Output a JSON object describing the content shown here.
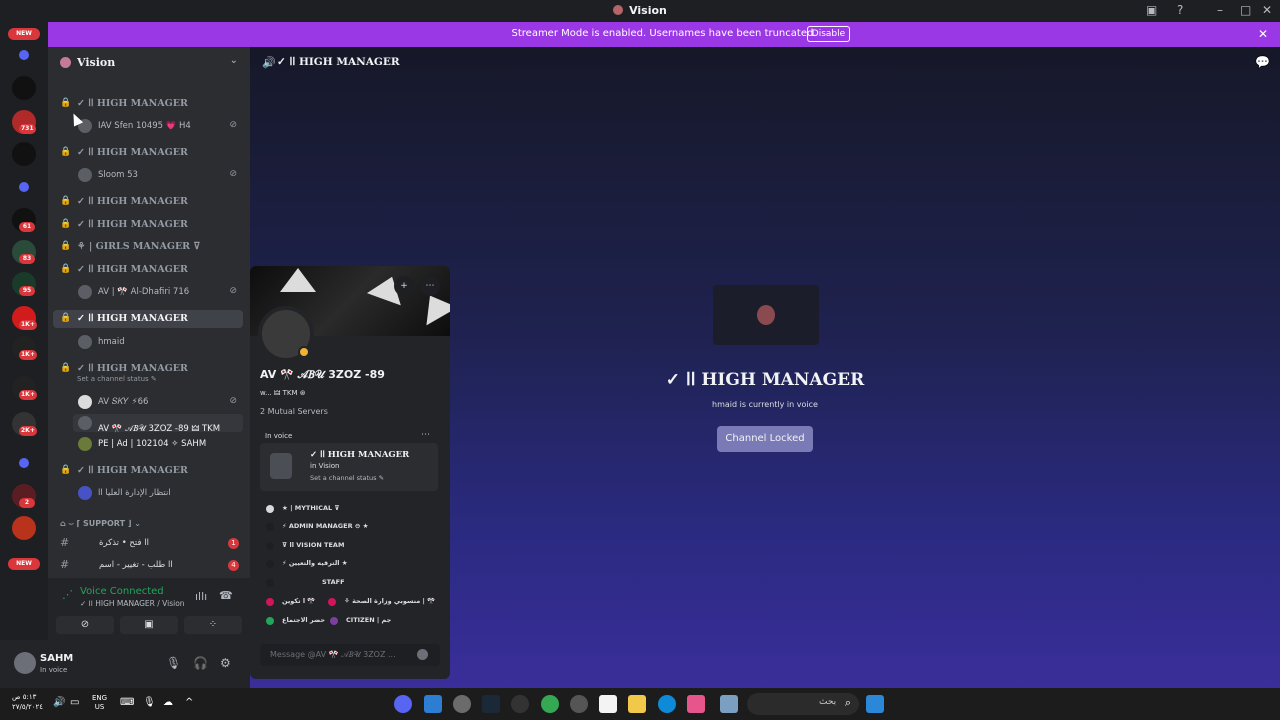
{
  "window": {
    "title": "Vision"
  },
  "banner": {
    "message": "Streamer Mode is enabled. Usernames have been truncated.",
    "disable_label": "Disable"
  },
  "guilds": {
    "new_top": "NEW",
    "badges": [
      "731",
      "61",
      "83",
      "95",
      "1K+",
      "1K+",
      "1K+",
      "2K+",
      "2"
    ],
    "new_bottom": "NEW"
  },
  "server": {
    "name": "Vision"
  },
  "channels": [
    {
      "label": "✓ اا HIGH MANAGER",
      "users": [
        {
          "name": "IAV Sfen 10495 💗 H4"
        }
      ]
    },
    {
      "label": "✓ اا HIGH MANAGER",
      "users": [
        {
          "name": "Sloom 53"
        }
      ]
    },
    {
      "label": "✓ اا HIGH MANAGER",
      "users": []
    },
    {
      "label": "✓ اا HIGH MANAGER",
      "users": []
    },
    {
      "label": "⚘ | GIRLS MANAGER ⊽",
      "users": []
    },
    {
      "label": "✓ اا HIGH MANAGER",
      "users": [
        {
          "name": "AV | 🎌 Al-Dhafiri 716"
        }
      ]
    },
    {
      "label": "✓ اا HIGH MANAGER",
      "users": [
        {
          "name": "hmaid"
        }
      ]
    },
    {
      "label": "✓ اا HIGH MANAGER",
      "status": "Set a channel status ✎",
      "users": [
        {
          "name": "AV 𝑆𝐾𝑌 ⚡66"
        },
        {
          "name": "AV 🎌 𝒜𝐵𝒰 3ZOZ -89 🜲 TKM"
        },
        {
          "name": "PE | Ad | 102104 ✧ SAHM"
        }
      ]
    },
    {
      "label": "✓ اا HIGH MANAGER",
      "users": [
        {
          "name": "انتظار الإدارة العليا اا"
        }
      ]
    }
  ],
  "category": {
    "label": "⌂ ⌣ ⌈ SUPPORT ⌋ ⌄"
  },
  "text_channels": [
    {
      "label": "اا فتح • تذكرة",
      "count": "1"
    },
    {
      "label": "اا طلب - تغيير - اسم",
      "count": "4"
    }
  ],
  "voice": {
    "status": "Voice Connected",
    "channel": "✓ اا HIGH MANAGER / Vision"
  },
  "user": {
    "name": "SAHM",
    "status": "In voice"
  },
  "main": {
    "header": "✓ اا HIGH MANAGER",
    "title": "✓ اا HIGH MANAGER",
    "subtitle": "hmaid is currently in voice",
    "locked_label": "Channel Locked"
  },
  "popout": {
    "name": "AV 🎌 𝒜𝐵𝒰 3ZOZ -89",
    "tag": "w... 🜲 TKM ⊛",
    "mutual": "2 Mutual Servers",
    "in_voice_label": "In voice",
    "voice_channel": "✓ اا HIGH MANAGER",
    "voice_in": "in Vision",
    "voice_status": "Set a channel status ✎",
    "roles": [
      {
        "label": "★ | MYTHICAL ⊽",
        "color": "#d9d9d9"
      },
      {
        "label": "⚡ ADMIN MANAGER ⊖ ★",
        "color": "#1e1f22"
      },
      {
        "label": "⊽ اا VISION TEAM",
        "color": "#1e1f22"
      },
      {
        "label": "⚡ الترقيه والتعيين ★",
        "color": "#1e1f22"
      },
      {
        "label": "STAFF",
        "color": "#1e1f22"
      },
      {
        "label": "ا تكوين 🎌",
        "color": "#d4145a"
      },
      {
        "label": "⚘ منسوبي وزارة الصحة | 🎌",
        "color": "#d4145a"
      },
      {
        "label": "حضر الاجتماع",
        "color": "#23a55a"
      },
      {
        "label": "CITIZEN | جم",
        "color": "#7b3fa0"
      }
    ],
    "message_placeholder": "Message @AV 🎌 𝒜𝐵𝒰 3ZOZ ..."
  },
  "taskbar": {
    "time": "٥:١٣ ص",
    "date": "٢٧/٥/٢٠٢٤",
    "lang_top": "ENG",
    "lang_bottom": "US",
    "search_text": "بحث"
  }
}
